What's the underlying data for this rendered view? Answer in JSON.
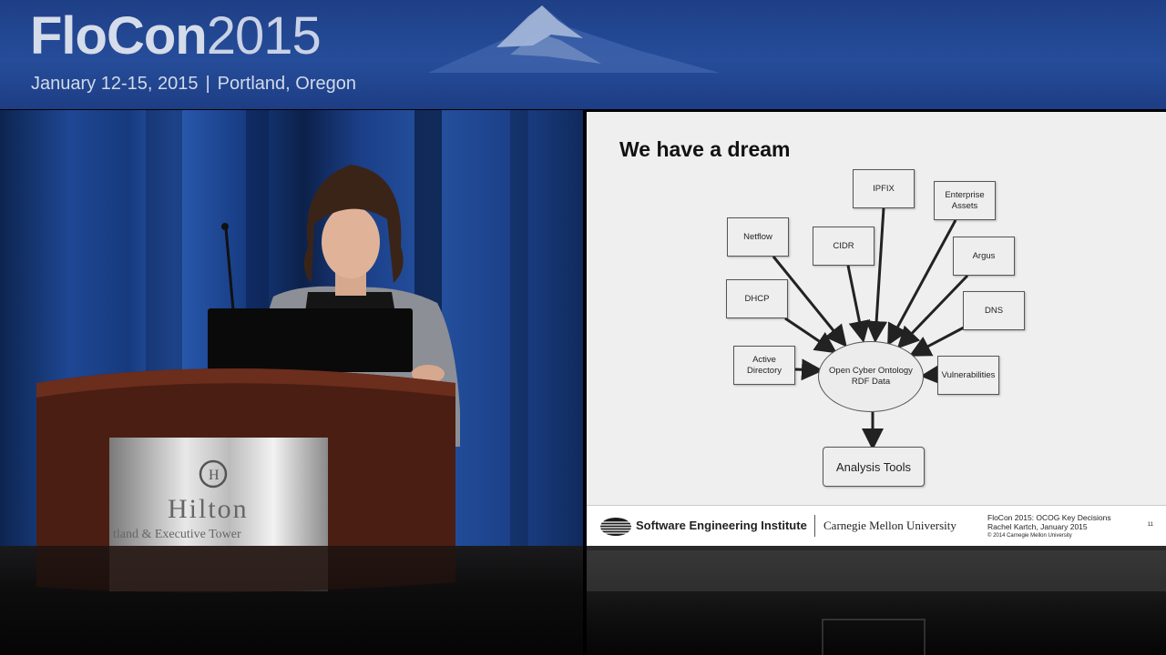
{
  "banner": {
    "logo_bold": "FloCon",
    "logo_year": "2015",
    "dates": "January 12-15, 2015",
    "separator": "|",
    "location": "Portland, Oregon"
  },
  "slide": {
    "title": "We have a dream",
    "diagram": {
      "center": {
        "line1": "Open Cyber Ontology",
        "line2": "RDF Data"
      },
      "sources": {
        "netflow": "Netflow",
        "ipfix": "IPFIX",
        "enterprise_line1": "Enterprise",
        "enterprise_line2": "Assets",
        "cidr": "CIDR",
        "argus": "Argus",
        "dhcp": "DHCP",
        "dns": "DNS",
        "ad_line1": "Active",
        "ad_line2": "Directory",
        "vulnerabilities": "Vulnerabilities"
      },
      "output": "Analysis Tools"
    },
    "footer": {
      "org": "Software Engineering Institute",
      "university": "Carnegie Mellon University",
      "talk": "FloCon 2015: OCOG Key Decisions",
      "speaker": "Rachel Kartch, January 2015",
      "copyright": "© 2014 Carnegie Mellon University",
      "page": "11"
    }
  },
  "podium": {
    "sign_name": "Hilton",
    "sign_sub": "tland & Executive Tower"
  },
  "colors": {
    "banner_blue": "#264d9a",
    "slide_bg": "#efefef",
    "curtain_blue": "#1e4793",
    "podium_wood": "#4a1e12"
  }
}
